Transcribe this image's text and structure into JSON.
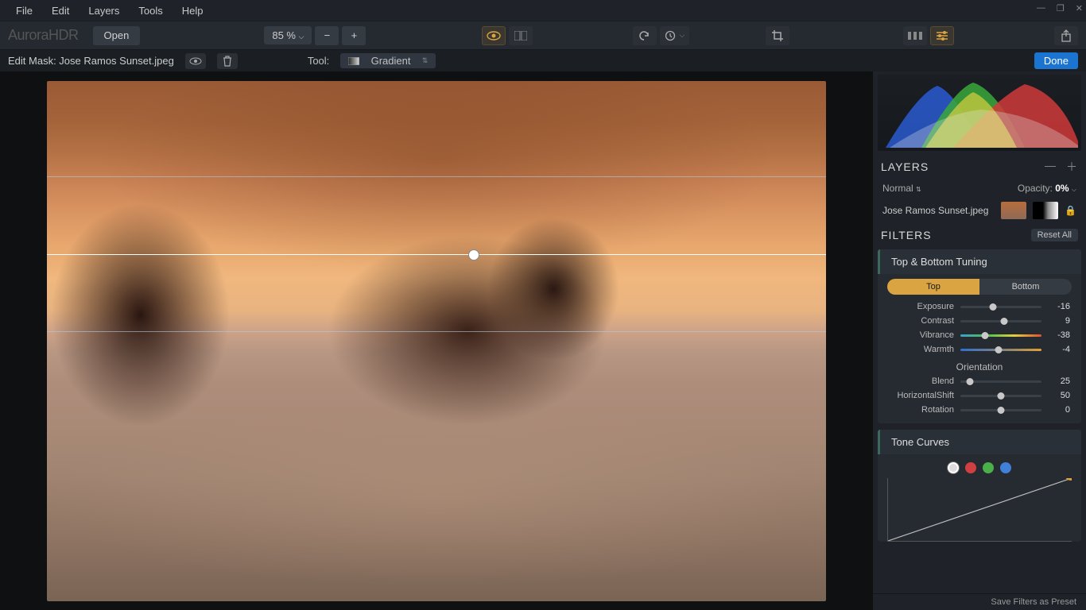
{
  "app_title": "AuroraHDR",
  "menus": [
    "File",
    "Edit",
    "Layers",
    "Tools",
    "Help"
  ],
  "toolbar": {
    "open_label": "Open",
    "zoom_label": "85 %",
    "minus": "−",
    "plus": "+"
  },
  "subtoolbar": {
    "mask_label": "Edit Mask: Jose Ramos Sunset.jpeg",
    "tool_label": "Tool:",
    "tool_value": "Gradient",
    "done_label": "Done"
  },
  "panel": {
    "layers_title": "LAYERS",
    "blend_mode": "Normal",
    "opacity_label": "Opacity:",
    "opacity_value": "0%",
    "layer_name": "Jose Ramos Sunset.jpeg",
    "filters_title": "FILTERS",
    "reset_all": "Reset All",
    "top_bottom": {
      "title": "Top & Bottom Tuning",
      "tab_top": "Top",
      "tab_bottom": "Bottom",
      "sliders": [
        {
          "label": "Exposure",
          "value": "-16",
          "pos": 40
        },
        {
          "label": "Contrast",
          "value": "9",
          "pos": 54
        },
        {
          "label": "Vibrance",
          "value": "-38",
          "pos": 30,
          "grad": "grad-red"
        },
        {
          "label": "Warmth",
          "value": "-4",
          "pos": 47,
          "grad": "grad-warm"
        }
      ],
      "orientation_title": "Orientation",
      "orientation": [
        {
          "label": "Blend",
          "value": "25",
          "pos": 12
        },
        {
          "label": "HorizontalShift",
          "value": "50",
          "pos": 50
        },
        {
          "label": "Rotation",
          "value": "0",
          "pos": 50
        }
      ]
    },
    "tone_curves_title": "Tone Curves",
    "footer": "Save Filters as Preset"
  }
}
